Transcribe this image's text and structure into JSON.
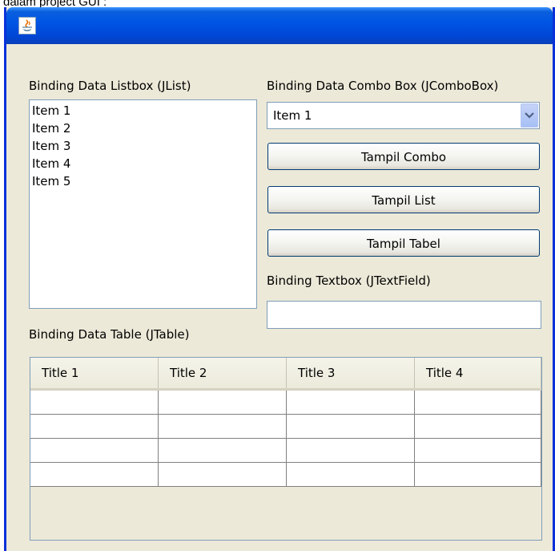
{
  "page_caption": "dalam project GUI :",
  "window": {
    "title_icon": "java-coffee-icon"
  },
  "list_section": {
    "label": "Binding Data Listbox (JList)",
    "items": [
      "Item 1",
      "Item 2",
      "Item 3",
      "Item 4",
      "Item 5"
    ]
  },
  "combo_section": {
    "label": "Binding Data Combo Box (JComboBox)",
    "selected": "Item 1",
    "arrow_icon": "chevron-down-icon"
  },
  "buttons": {
    "tampil_combo": "Tampil Combo",
    "tampil_list": "Tampil List",
    "tampil_tabel": "Tampil Tabel"
  },
  "textbox_section": {
    "label": "Binding Textbox (JTextField)",
    "value": ""
  },
  "table_section": {
    "label": "Binding Data Table (JTable)",
    "columns": [
      "Title 1",
      "Title 2",
      "Title 3",
      "Title 4"
    ],
    "rows": [
      [
        "",
        "",
        "",
        ""
      ],
      [
        "",
        "",
        "",
        ""
      ],
      [
        "",
        "",
        "",
        ""
      ],
      [
        "",
        "",
        "",
        ""
      ]
    ]
  },
  "colors": {
    "titlebar": "#0055e5",
    "panel_bg": "#ece9d8",
    "field_border": "#7f9db9",
    "button_border": "#003c74"
  }
}
